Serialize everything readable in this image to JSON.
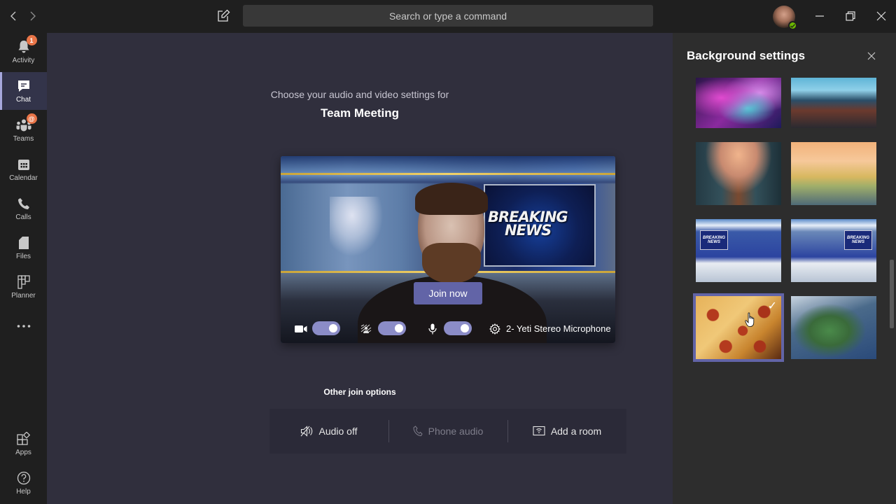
{
  "titlebar": {
    "back_icon": "chevron-left-icon",
    "forward_icon": "chevron-right-icon",
    "compose_icon": "compose-icon",
    "search_placeholder": "Search or type a command",
    "presence_status": "available",
    "window_controls": [
      "minimize",
      "maximize",
      "close"
    ]
  },
  "rail": {
    "items": [
      {
        "label": "Activity",
        "icon": "bell-icon",
        "badge": "1",
        "active": false
      },
      {
        "label": "Chat",
        "icon": "chat-icon",
        "badge": null,
        "active": true
      },
      {
        "label": "Teams",
        "icon": "teams-icon",
        "badge": "@",
        "active": false
      },
      {
        "label": "Calendar",
        "icon": "calendar-icon",
        "badge": null,
        "active": false
      },
      {
        "label": "Calls",
        "icon": "phone-icon",
        "badge": null,
        "active": false
      },
      {
        "label": "Files",
        "icon": "file-icon",
        "badge": null,
        "active": false
      },
      {
        "label": "Planner",
        "icon": "planner-icon",
        "badge": null,
        "active": false
      }
    ],
    "more_icon": "more-icon",
    "bottom": [
      {
        "label": "Apps",
        "icon": "apps-icon"
      },
      {
        "label": "Help",
        "icon": "help-icon"
      }
    ]
  },
  "prejoin": {
    "subtitle": "Choose your audio and video settings for",
    "meeting_title": "Team Meeting",
    "preview_background_text": [
      "BREAKING",
      "NEWS"
    ],
    "join_label": "Join now",
    "camera_on": true,
    "background_blur_on": true,
    "mic_on": true,
    "device_label": "2- Yeti Stereo Microphone",
    "other_join_title": "Other join options",
    "options": [
      {
        "label": "Audio off",
        "icon": "speaker-off-icon",
        "enabled": true
      },
      {
        "label": "Phone audio",
        "icon": "phone-icon",
        "enabled": false
      },
      {
        "label": "Add a room",
        "icon": "room-icon",
        "enabled": true
      }
    ]
  },
  "background_panel": {
    "title": "Background settings",
    "thumbnails": [
      {
        "name": "galaxy",
        "selected": false
      },
      {
        "name": "cliffside-lake",
        "selected": false
      },
      {
        "name": "autumn-street",
        "selected": false
      },
      {
        "name": "painted-landscape",
        "selected": false
      },
      {
        "name": "news-studio-left",
        "selected": false,
        "text": "BREAKING NEWS"
      },
      {
        "name": "news-studio-right",
        "selected": false,
        "text": "BREAKING NEWS"
      },
      {
        "name": "pizza",
        "selected": true
      },
      {
        "name": "weather-map",
        "selected": false
      }
    ],
    "check_glyph": "✓"
  },
  "colors": {
    "accent": "#6264a7",
    "toggle_on": "#8b8cc7",
    "badge": "#e97548",
    "presence_available": "#6bb700",
    "main_bg": "#302f3d",
    "panel_bg": "#2d2d2d",
    "rail_bg": "#1f1f1f"
  }
}
